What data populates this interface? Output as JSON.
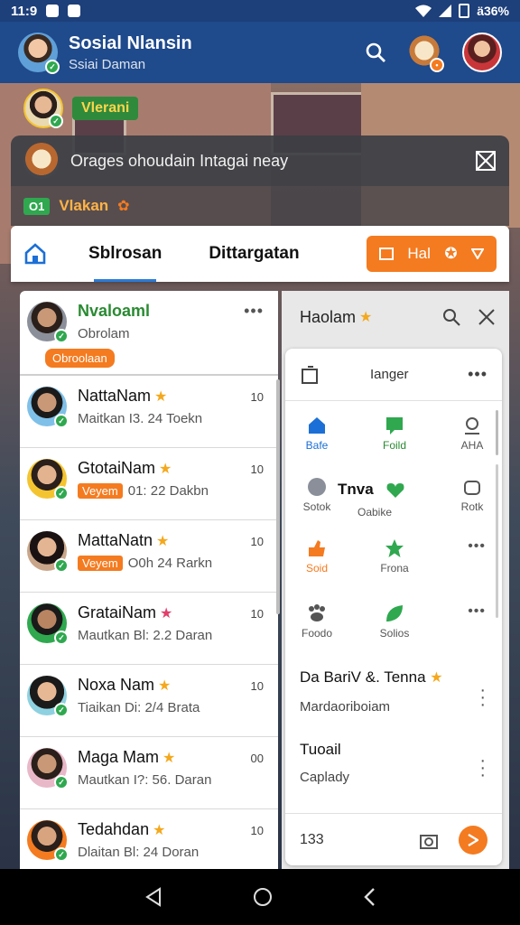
{
  "status_bar": {
    "time": "11:9",
    "battery_text": "ä36%"
  },
  "app_bar": {
    "title": "Sosial Nlansin",
    "subtitle": "Ssiai Daman"
  },
  "story": {
    "label": "Vlerani"
  },
  "notice": {
    "text": "Orages ohoudain Intagai neay",
    "tag": "O1",
    "label": "Vlakan"
  },
  "tabs": [
    {
      "label": "Sblrosan"
    },
    {
      "label": "Dittargatan"
    }
  ],
  "action_button": {
    "label": "Hal"
  },
  "contacts": {
    "first": {
      "name": "Nvaloaml",
      "sub": "Obrolam",
      "pill": "Obroolaan"
    },
    "items": [
      {
        "name": "NattaNam",
        "sub": "Maitkan I3. 24 Toekn",
        "tag": "",
        "time": "10",
        "star": "gold"
      },
      {
        "name": "GtotaiNam",
        "sub": "01: 22 Dakbn",
        "tag": "Veyem",
        "time": "10",
        "star": "gold"
      },
      {
        "name": "MattaNatn",
        "sub": "O0h 24 Rarkn",
        "tag": "Veyem",
        "time": "10",
        "star": "gold"
      },
      {
        "name": "GrataiNam",
        "sub": "Mautkan Bl: 2.2 Daran",
        "tag": "",
        "time": "10",
        "star": "pink"
      },
      {
        "name": "Noxa Nam",
        "sub": "Tiaikan Di: 2/4 Brata",
        "tag": "",
        "time": "10",
        "star": "gold"
      },
      {
        "name": "Maga Mam",
        "sub": "Mautkan I?: 56. Daran",
        "tag": "",
        "time": "00",
        "star": "gold"
      },
      {
        "name": "Tedahdan",
        "sub": "Dlaitan Bl: 24 Doran",
        "tag": "",
        "time": "10",
        "star": "gold"
      }
    ]
  },
  "side_panel": {
    "title": "Haolam",
    "card_label": "Ianger",
    "grid": [
      {
        "label": "Bafe",
        "icon": "home-icon",
        "color": "blue"
      },
      {
        "label": "Foild",
        "icon": "chat-icon",
        "color": "green"
      },
      {
        "label": "AHA",
        "icon": "support-icon",
        "color": "gray"
      },
      {
        "label": "Sotok",
        "icon": "sticker-icon",
        "color": "gray"
      },
      {
        "label": "Oabike",
        "icon": "",
        "color": "gray"
      },
      {
        "label": "Rotk",
        "icon": "puzzle-icon",
        "color": "gray"
      },
      {
        "label": "Soid",
        "icon": "thumb-icon",
        "color": "orange"
      },
      {
        "label": "Frona",
        "icon": "star-icon",
        "color": "gray"
      },
      {
        "label": "Foodo",
        "icon": "paw-icon",
        "color": "gray"
      },
      {
        "label": "Solios",
        "icon": "leaf-icon",
        "color": "gray"
      }
    ],
    "tnva_label": "Tnva",
    "row1_title": "Da BariV &. Tenna",
    "row1_sub": "Mardaoriboiam",
    "row2_title": "Tuoail",
    "row2_sub": "Caplady",
    "footer_count": "133"
  }
}
